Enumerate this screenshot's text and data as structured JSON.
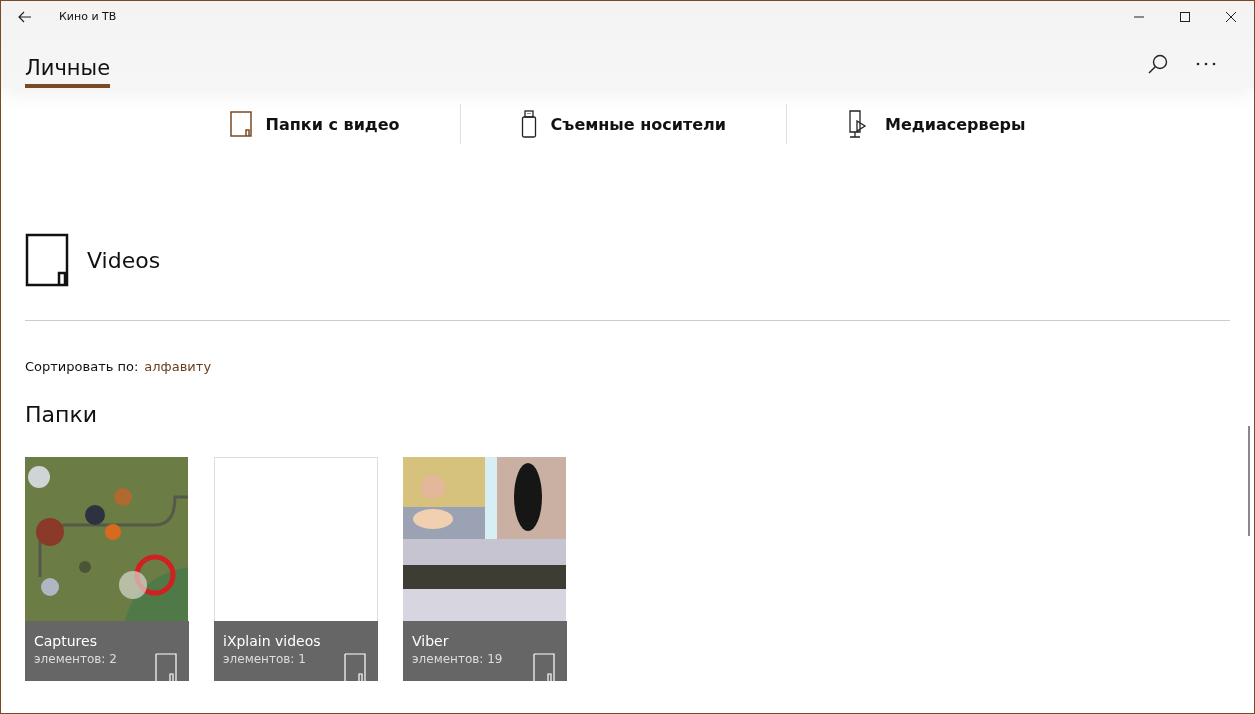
{
  "window": {
    "title": "Кино и ТВ"
  },
  "tabs": [
    {
      "label": "Личные",
      "selected": true
    }
  ],
  "sources": [
    {
      "kind": "folder",
      "label": "Папки с видео"
    },
    {
      "kind": "usb",
      "label": "Съемные носители"
    },
    {
      "kind": "server",
      "label": "Медиасерверы"
    }
  ],
  "library": {
    "title": "Videos",
    "sort_label": "Сортировать по:",
    "sort_value": "алфавиту",
    "section": "Папки"
  },
  "folders": [
    {
      "name": "Captures",
      "count": "элементов: 2",
      "kind": "picture"
    },
    {
      "name": "iXplain videos",
      "count": "элементов: 1",
      "kind": "blank"
    },
    {
      "name": "Viber",
      "count": "элементов: 19",
      "kind": "picture"
    }
  ]
}
